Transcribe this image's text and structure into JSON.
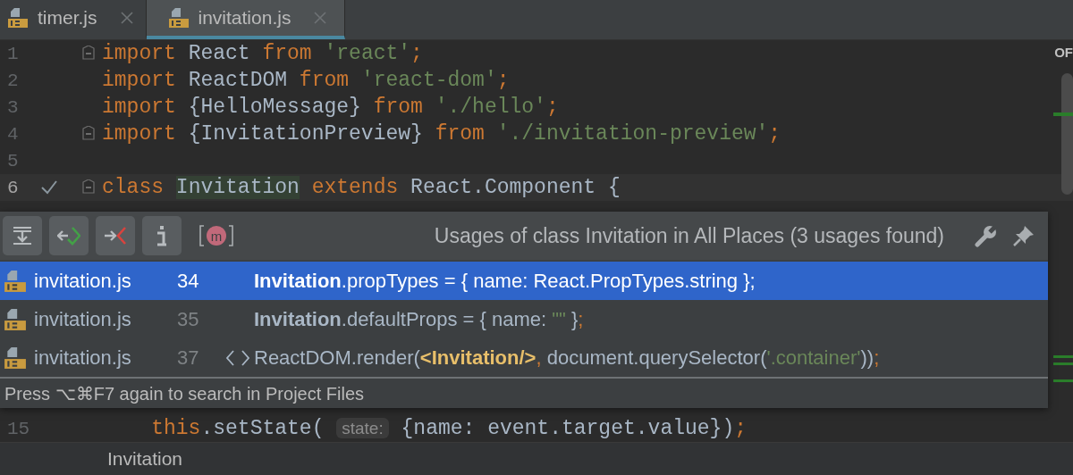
{
  "tabs": [
    {
      "label": "timer.js",
      "selected": false
    },
    {
      "label": "invitation.js",
      "selected": true
    }
  ],
  "editor": {
    "lines": [
      {
        "number": "1",
        "fold": true,
        "current": false,
        "checked": false,
        "tokens": [
          {
            "kind": "keyword",
            "text": "import"
          },
          {
            "kind": "ident",
            "text": " React "
          },
          {
            "kind": "keyword",
            "text": "from "
          },
          {
            "kind": "string",
            "text": "'react'"
          },
          {
            "kind": "keyword",
            "text": ";"
          }
        ]
      },
      {
        "number": "2",
        "fold": false,
        "current": false,
        "checked": false,
        "tokens": [
          {
            "kind": "keyword",
            "text": "import"
          },
          {
            "kind": "ident",
            "text": " ReactDOM "
          },
          {
            "kind": "keyword",
            "text": "from "
          },
          {
            "kind": "string",
            "text": "'react-dom'"
          },
          {
            "kind": "keyword",
            "text": ";"
          }
        ]
      },
      {
        "number": "3",
        "fold": false,
        "current": false,
        "checked": false,
        "tokens": [
          {
            "kind": "keyword",
            "text": "import"
          },
          {
            "kind": "ident",
            "text": " {HelloMessage} "
          },
          {
            "kind": "keyword",
            "text": "from "
          },
          {
            "kind": "string",
            "text": "'./hello'"
          },
          {
            "kind": "keyword",
            "text": ";"
          }
        ]
      },
      {
        "number": "4",
        "fold": true,
        "current": false,
        "checked": false,
        "tokens": [
          {
            "kind": "keyword",
            "text": "import"
          },
          {
            "kind": "ident",
            "text": " {InvitationPreview} "
          },
          {
            "kind": "keyword",
            "text": "from "
          },
          {
            "kind": "string",
            "text": "'./invitation-preview'"
          },
          {
            "kind": "keyword",
            "text": ";"
          }
        ]
      },
      {
        "number": "5",
        "fold": false,
        "current": false,
        "checked": false
      },
      {
        "number": "6",
        "fold": true,
        "current": true,
        "checked": true,
        "tokens": [
          {
            "kind": "keyword",
            "text": "class "
          },
          {
            "kind": "usage",
            "text": "Invitation"
          },
          {
            "kind": "keyword",
            "text": " extends"
          },
          {
            "kind": "ident",
            "text": " React.Component {"
          }
        ]
      },
      {
        "number": "15",
        "fold": false,
        "current": false,
        "checked": false,
        "tokens": [
          {
            "kind": "keyword",
            "text": "    this"
          },
          {
            "kind": "ident",
            "text": ".setState( "
          },
          {
            "kind": "hint",
            "text": "state:"
          },
          {
            "kind": "ident",
            "text": " {name: event.target.value})"
          },
          {
            "kind": "keyword",
            "text": ";"
          }
        ]
      }
    ],
    "stripe_label": "OF"
  },
  "usages_popup": {
    "title": "Usages of class Invitation in All Places (3 usages found)",
    "toolbar": [
      {
        "kind": "expand"
      },
      {
        "kind": "previous"
      },
      {
        "kind": "next"
      },
      {
        "kind": "info"
      },
      {
        "kind": "badge",
        "label": "m"
      }
    ],
    "rows": [
      {
        "file": "invitation.js",
        "line": "34",
        "selected": true,
        "tag_icon": false,
        "segments": [
          {
            "kind": "bold",
            "text": "Invitation"
          },
          {
            "kind": "plain",
            "text": ".propTypes = { name: React.PropTypes.string }"
          },
          {
            "kind": "semi",
            "text": ";"
          }
        ]
      },
      {
        "file": "invitation.js",
        "line": "35",
        "selected": false,
        "tag_icon": false,
        "segments": [
          {
            "kind": "bold",
            "text": "Invitation"
          },
          {
            "kind": "plain",
            "text": ".defaultProps = { name: "
          },
          {
            "kind": "string",
            "text": "\"\""
          },
          {
            "kind": "plain",
            "text": " }"
          },
          {
            "kind": "semi",
            "text": ";"
          }
        ]
      },
      {
        "file": "invitation.js",
        "line": "37",
        "selected": false,
        "tag_icon": true,
        "segments": [
          {
            "kind": "plain",
            "text": "ReactDOM.render("
          },
          {
            "kind": "jsx",
            "text": "<Invitation/>"
          },
          {
            "kind": "semi",
            "text": ","
          },
          {
            "kind": "plain",
            "text": " document.querySelector("
          },
          {
            "kind": "string",
            "text": "'.container'"
          },
          {
            "kind": "plain",
            "text": "))"
          },
          {
            "kind": "semi",
            "text": ";"
          }
        ]
      }
    ],
    "footer": "Press ⌥⌘F7 again to search in Project Files"
  },
  "breadcrumb": "Invitation"
}
